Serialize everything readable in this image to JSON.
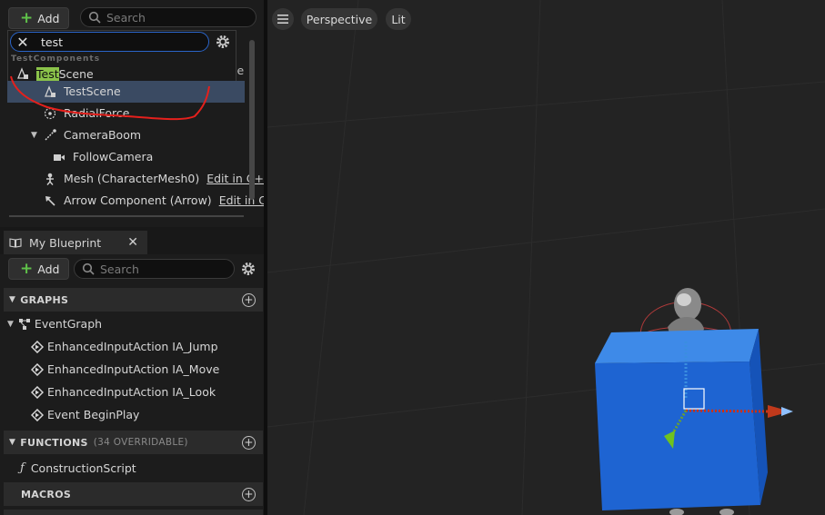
{
  "components_panel": {
    "add_label": "Add",
    "search_placeholder": "Search",
    "filter_value": "test",
    "category": "TestComponents",
    "result": {
      "highlight": "Test",
      "rest": "Scene"
    },
    "partial_label": "le",
    "items": [
      {
        "label": "TestScene",
        "icon": "scene-component-icon"
      },
      {
        "label": "RadialForce",
        "icon": "radial-force-icon"
      },
      {
        "label": "CameraBoom",
        "icon": "spring-arm-icon"
      },
      {
        "label": "FollowCamera",
        "icon": "camera-icon"
      },
      {
        "label": "Mesh (CharacterMesh0)",
        "icon": "skeletal-mesh-icon",
        "edit": "Edit in C+"
      },
      {
        "label": "Arrow Component (Arrow)",
        "icon": "arrow-icon",
        "edit": "Edit in C"
      }
    ]
  },
  "my_blueprint": {
    "tab_title": "My Blueprint",
    "add_label": "Add",
    "search_placeholder": "Search",
    "sections": {
      "graphs": "GRAPHS",
      "functions": "FUNCTIONS",
      "functions_sub": "(34 OVERRIDABLE)",
      "macros": "MACROS"
    },
    "event_graph": "EventGraph",
    "events": [
      "EnhancedInputAction IA_Jump",
      "EnhancedInputAction IA_Move",
      "EnhancedInputAction IA_Look",
      "Event BeginPlay"
    ],
    "construction_script": "ConstructionScript"
  },
  "viewport": {
    "view_mode": "Perspective",
    "lighting": "Lit",
    "colors": {
      "cube": "#1e64d2",
      "accent": "#2a64c8"
    }
  }
}
